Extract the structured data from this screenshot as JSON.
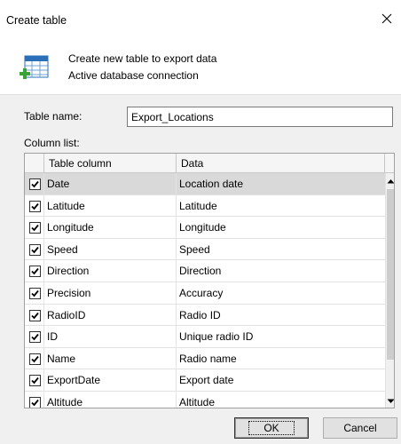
{
  "window": {
    "title": "Create table"
  },
  "header": {
    "line1": "Create new table to export data",
    "line2": "Active database connection"
  },
  "form": {
    "table_name_label": "Table name:",
    "table_name_value": "Export_Locations",
    "column_list_label": "Column list:"
  },
  "grid": {
    "headers": [
      "",
      "Table column",
      "Data"
    ],
    "rows": [
      {
        "checked": true,
        "column": "Date",
        "data": "Location date",
        "selected": true
      },
      {
        "checked": true,
        "column": "Latitude",
        "data": "Latitude"
      },
      {
        "checked": true,
        "column": "Longitude",
        "data": "Longitude"
      },
      {
        "checked": true,
        "column": "Speed",
        "data": "Speed"
      },
      {
        "checked": true,
        "column": "Direction",
        "data": "Direction"
      },
      {
        "checked": true,
        "column": "Precision",
        "data": "Accuracy"
      },
      {
        "checked": true,
        "column": "RadioID",
        "data": "Radio ID"
      },
      {
        "checked": true,
        "column": "ID",
        "data": "Unique radio ID"
      },
      {
        "checked": true,
        "column": "Name",
        "data": "Radio name"
      },
      {
        "checked": true,
        "column": "ExportDate",
        "data": "Export date"
      },
      {
        "checked": true,
        "column": "Altitude",
        "data": "Altitude"
      }
    ]
  },
  "buttons": {
    "ok_label": "OK",
    "cancel_label": "Cancel"
  },
  "icons": {
    "close": "close-icon",
    "header": "database-table-icon",
    "scroll_up": "arrow-up-icon",
    "scroll_down": "arrow-down-icon",
    "check": "check-icon"
  },
  "colors": {
    "selected_row": "#d9d9d9",
    "dialog_body": "#f0f0f0",
    "icon_blue": "#2a6fb8",
    "icon_green": "#3aa335"
  }
}
